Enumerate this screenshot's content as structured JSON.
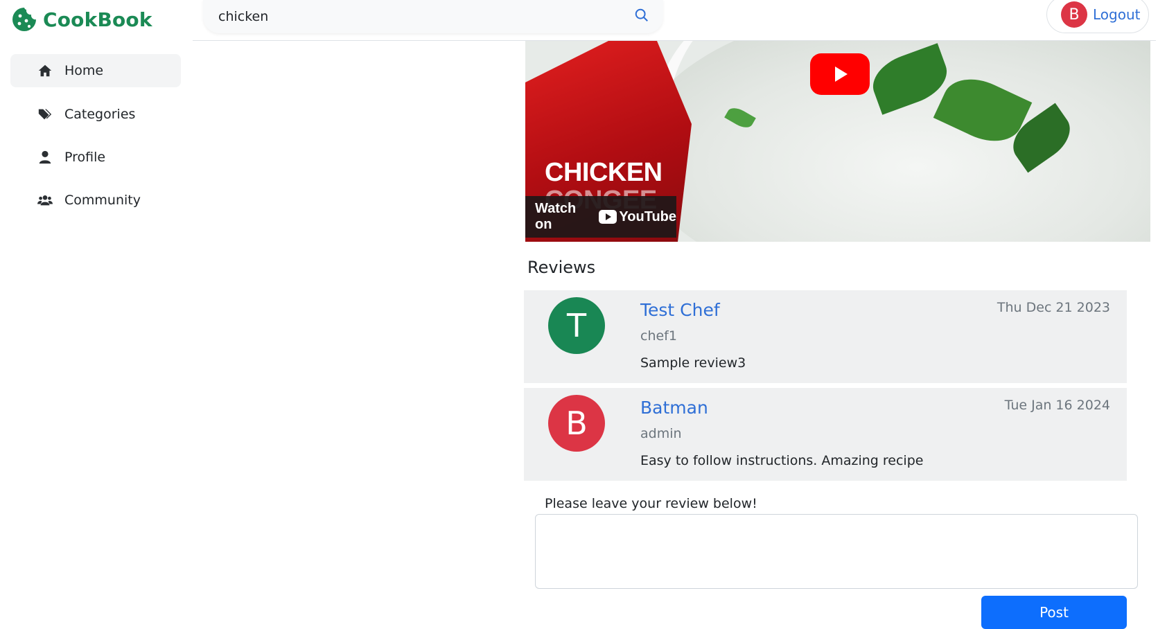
{
  "brand": {
    "name": "CookBook"
  },
  "sidebar": {
    "items": [
      {
        "label": "Home",
        "icon": "home-icon",
        "active": true
      },
      {
        "label": "Categories",
        "icon": "tags-icon",
        "active": false
      },
      {
        "label": "Profile",
        "icon": "user-icon",
        "active": false
      },
      {
        "label": "Community",
        "icon": "users-icon",
        "active": false
      }
    ]
  },
  "search": {
    "value": "chicken"
  },
  "user": {
    "initial": "B",
    "logout_label": "Logout",
    "avatar_color": "#dc3545"
  },
  "video": {
    "title_line1": "CHICKEN",
    "title_line2": "CONGEE",
    "watch_on": "Watch on",
    "youtube": "YouTube"
  },
  "reviews": {
    "heading": "Reviews",
    "items": [
      {
        "initial": "T",
        "avatar_color": "#198754",
        "name": "Test Chef",
        "username": "chef1",
        "date": "Thu Dec 21 2023",
        "text": "Sample review3"
      },
      {
        "initial": "B",
        "avatar_color": "#dc3545",
        "name": "Batman",
        "username": "admin",
        "date": "Tue Jan 16 2024",
        "text": "Easy to follow instructions. Amazing recipe"
      }
    ],
    "leave_label": "Please leave your review below!",
    "post_label": "Post"
  },
  "colors": {
    "brand": "#1b8a55",
    "link": "#2f6fd6",
    "primary": "#0d6efd"
  }
}
